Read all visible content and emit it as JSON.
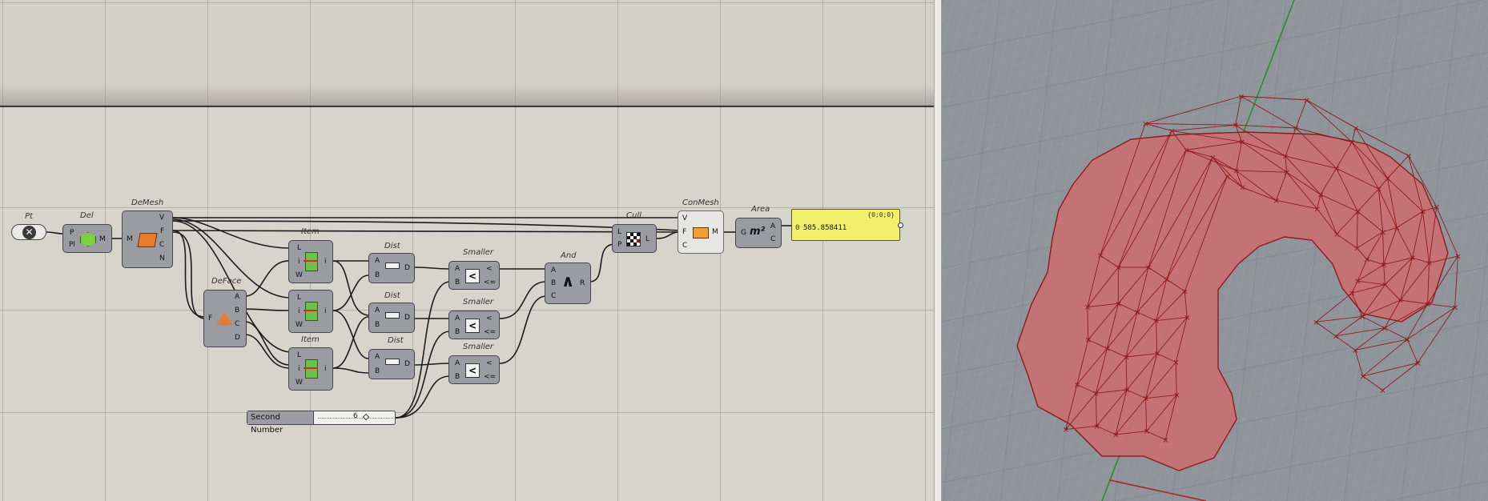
{
  "canvas": {
    "components": {
      "pt": "Pt",
      "del": "Del",
      "demesh": "DeMesh",
      "deface": "DeFace",
      "item": "Item",
      "dist": "Dist",
      "smaller": "Smaller",
      "and": "And",
      "cull": "Cull",
      "conmesh": "ConMesh",
      "area": "Area"
    },
    "ports": {
      "p": "P",
      "pl": "Pl",
      "m": "M",
      "v": "V",
      "f": "F",
      "c": "C",
      "n": "N",
      "a": "A",
      "b": "B",
      "d": "D",
      "l": "L",
      "i": "i",
      "w": "W",
      "lt": "<",
      "le": "<=",
      "r": "R",
      "g": "G"
    },
    "area_panel": {
      "header": "{0;0;0}",
      "index": "0",
      "value": "585.858411"
    },
    "slider": {
      "label": "Second Number",
      "value": "6"
    }
  },
  "colors": {
    "canvas_bg": "#d7d4cc",
    "component": "#9a9ba3",
    "panel_yellow": "#f2ef6a",
    "mesh_fill": "#c96f73",
    "mesh_edge": "#8e1c1c",
    "viewport_bg": "#8e949a"
  }
}
